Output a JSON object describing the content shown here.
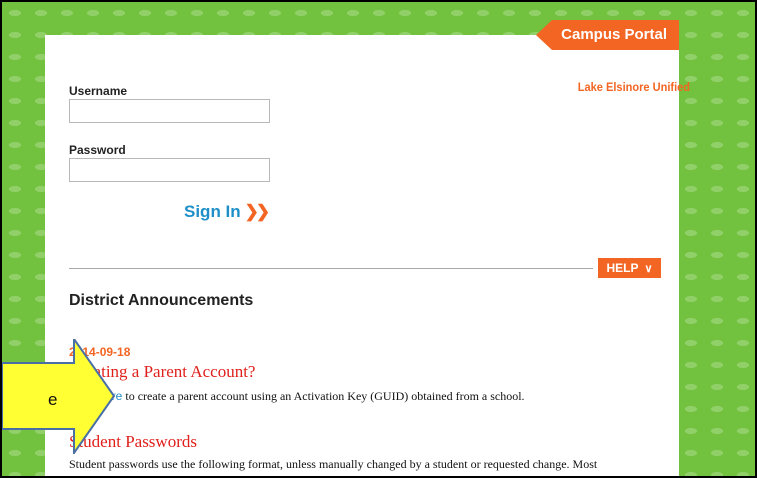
{
  "portal": {
    "tab_title": "Campus Portal",
    "district": "Lake Elsinore Unified"
  },
  "login": {
    "username_label": "Username",
    "password_label": "Password",
    "sign_in_label": "Sign In",
    "sign_in_arrow": "❯❯"
  },
  "help": {
    "label": "HELP",
    "chevron": "∨"
  },
  "announcements": {
    "title": "District Announcements",
    "date": "2014-09-18",
    "items": [
      {
        "heading": "Creating a Parent Account?",
        "link": "Click here",
        "text": " to create a parent account using an Activation Key (GUID) obtained from a school."
      },
      {
        "heading": "Student Passwords",
        "text": "Student passwords use the following format, unless manually changed by a student or requested change. Most"
      }
    ]
  },
  "callout": {
    "text": "e",
    "color": "#ffff33"
  }
}
